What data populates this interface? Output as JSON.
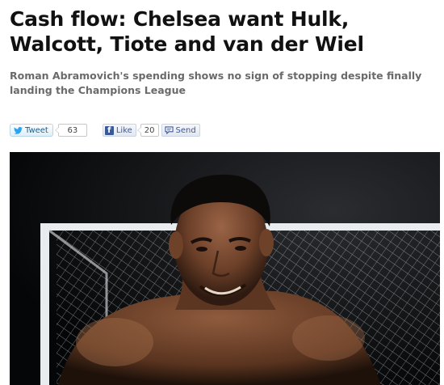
{
  "article": {
    "headline": "Cash flow: Chelsea want Hulk, Walcott, Tiote and van der Wiel",
    "standfirst": "Roman Abramovich's spending shows no sign of stopping despite finally landing the Champions League"
  },
  "share": {
    "tweet_label": "Tweet",
    "tweet_count": "63",
    "like_label": "Like",
    "like_count": "20",
    "send_label": "Send",
    "twitter_color": "#1f5f86",
    "facebook_color": "#3b5998"
  },
  "hero_image": {
    "description_icon": "footballer-photo"
  }
}
